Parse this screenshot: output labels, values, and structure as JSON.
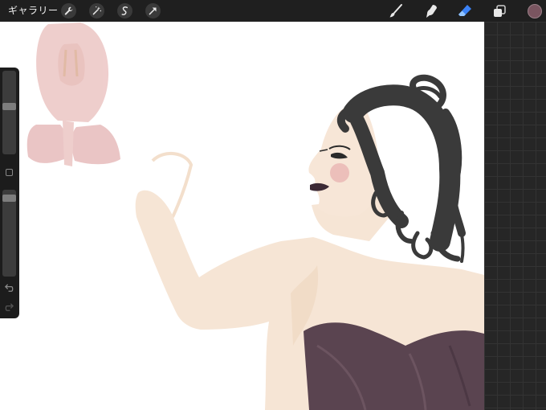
{
  "topbar": {
    "gallery_label": "ギャラリー",
    "left_tools": [
      "wrench-icon",
      "magic-wand-icon",
      "selection-icon",
      "transform-arrow-icon"
    ],
    "right_tools": [
      "brush-icon",
      "smudge-icon",
      "eraser-icon",
      "layers-icon"
    ],
    "active_tool": "eraser-icon",
    "current_color": "#7a5560"
  },
  "sidebar": {
    "brush_size_level": 0.25,
    "opacity_level": 0.1,
    "controls": [
      "brush-size-slider",
      "modify-button",
      "opacity-slider",
      "undo-icon",
      "redo-icon"
    ]
  },
  "colors": {
    "canvas": "#ffffff",
    "accent_active_tool": "#3b82f6",
    "skin": "#f5e3d3",
    "hair": "#383838",
    "dress": "#5a4450",
    "sketch": "#e7bcbc"
  }
}
